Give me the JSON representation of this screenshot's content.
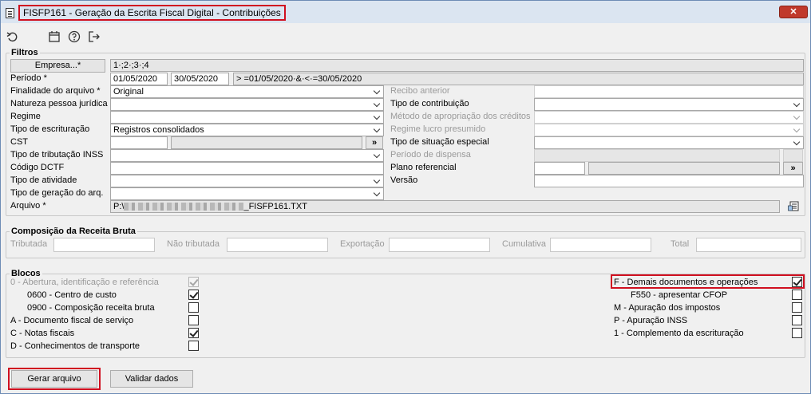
{
  "window": {
    "title": "FISFP161 - Geração da Escrita Fiscal Digital - Contribuições",
    "close": "✕"
  },
  "filtros": {
    "legend": "Filtros",
    "empresa_button": "Empresa...*",
    "empresa_value": "1·;2·;3·;4",
    "periodo_label": "Período *",
    "periodo_start": "01/05/2020",
    "periodo_end": "30/05/2020",
    "periodo_expr": "> =01/05/2020·&·<·=30/05/2020",
    "finalidade_label": "Finalidade do arquivo *",
    "finalidade_value": "Original",
    "natureza_label": "Natureza pessoa jurídica",
    "regime_label": "Regime",
    "tipo_escrituracao_label": "Tipo de escrituração",
    "tipo_escrituracao_value": "Registros consolidados",
    "cst_label": "CST",
    "cst_more": "»",
    "tipo_tributacao_label": "Tipo de tributação INSS",
    "codigo_dctf_label": "Código DCTF",
    "tipo_atividade_label": "Tipo de atividade",
    "tipo_geracao_label": "Tipo de geração do arq.",
    "arquivo_label": "Arquivo *",
    "arquivo_prefix": "P:\\",
    "arquivo_suffix": "_FISFP161.TXT",
    "recibo_label": "Recibo anterior",
    "tipo_contribuicao_label": "Tipo de contribuição",
    "metodo_label": "Método de apropriação dos créditos",
    "regime_lucro_label": "Regime lucro presumido",
    "tipo_situacao_label": "Tipo de situação especial",
    "periodo_dispensa_label": "Período de dispensa",
    "plano_label": "Plano referencial",
    "plano_more": "»",
    "versao_label": "Versão"
  },
  "composicao": {
    "legend": "Composição da Receita Bruta",
    "tributada": "Tributada",
    "nao_tributada": "Não tributada",
    "exportacao": "Exportação",
    "cumulativa": "Cumulativa",
    "total": "Total"
  },
  "blocos": {
    "legend": "Blocos",
    "left": [
      {
        "label": "0 - Abertura, identificação e referência",
        "checked": true,
        "disabled": true
      },
      {
        "label": "0600 - Centro de custo",
        "checked": true
      },
      {
        "label": "0900 - Composição receita bruta",
        "checked": false
      },
      {
        "label": "A - Documento fiscal de serviço",
        "checked": false
      },
      {
        "label": "C - Notas fiscais",
        "checked": true
      },
      {
        "label": "D - Conhecimentos de transporte",
        "checked": false
      }
    ],
    "right": [
      {
        "label": "F - Demais documentos e operações",
        "checked": true
      },
      {
        "label": "F550 - apresentar CFOP",
        "checked": false
      },
      {
        "label": "M - Apuração dos impostos",
        "checked": false
      },
      {
        "label": "P - Apuração INSS",
        "checked": false
      },
      {
        "label": "1 - Complemento da escrituração",
        "checked": false
      }
    ]
  },
  "footer": {
    "gerar": "Gerar arquivo",
    "validar": "Validar dados"
  }
}
